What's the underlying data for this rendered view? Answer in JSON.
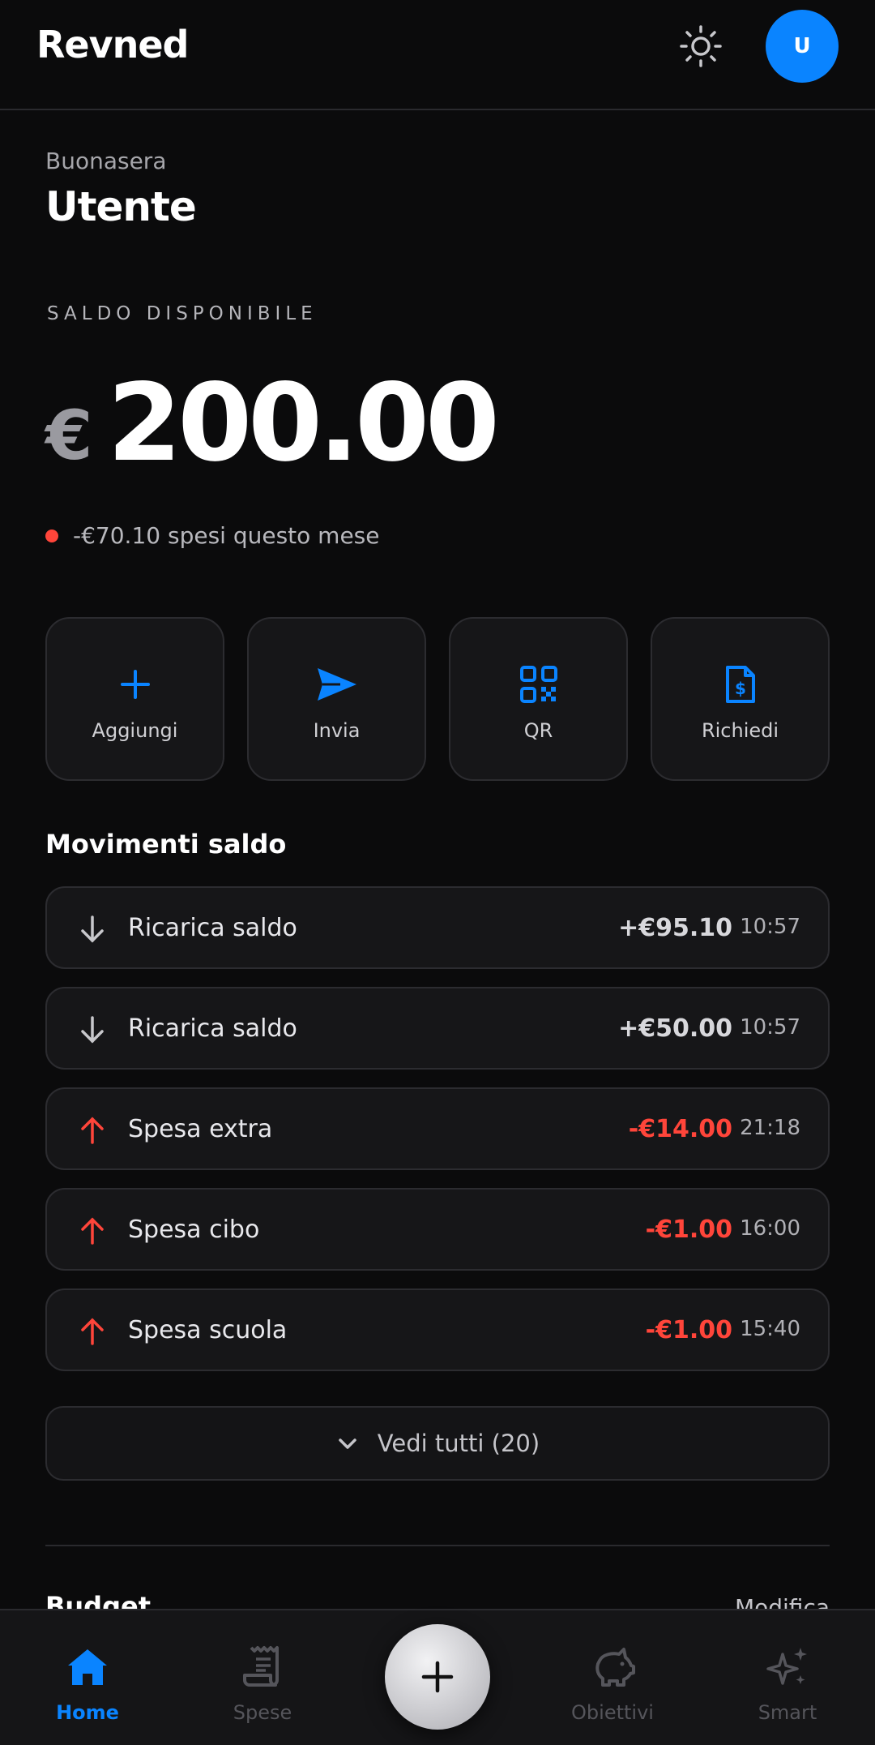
{
  "header": {
    "brand": "Revned",
    "avatar_initial": "U"
  },
  "greeting": {
    "salutation": "Buonasera",
    "name": "Utente"
  },
  "balance": {
    "label": "SALDO DISPONIBILE",
    "currency": "€",
    "amount": "200.00",
    "spent_text": "-€70.10 spesi questo mese"
  },
  "actions": [
    {
      "label": "Aggiungi",
      "icon": "plus-icon"
    },
    {
      "label": "Invia",
      "icon": "send-icon"
    },
    {
      "label": "QR",
      "icon": "qr-icon"
    },
    {
      "label": "Richiedi",
      "icon": "invoice-icon"
    }
  ],
  "movements": {
    "title": "Movimenti saldo",
    "items": [
      {
        "label": "Ricarica saldo",
        "amount": "+€95.10",
        "time": "10:57",
        "direction": "in"
      },
      {
        "label": "Ricarica saldo",
        "amount": "+€50.00",
        "time": "10:57",
        "direction": "in"
      },
      {
        "label": "Spesa extra",
        "amount": "-€14.00",
        "time": "21:18",
        "direction": "out"
      },
      {
        "label": "Spesa cibo",
        "amount": "-€1.00",
        "time": "16:00",
        "direction": "out"
      },
      {
        "label": "Spesa scuola",
        "amount": "-€1.00",
        "time": "15:40",
        "direction": "out"
      }
    ],
    "see_all": "Vedi tutti (20)"
  },
  "budget": {
    "title": "Budget",
    "edit": "Modifica"
  },
  "nav": {
    "home": "Home",
    "spese": "Spese",
    "obiettivi": "Obiettivi",
    "smart": "Smart"
  },
  "colors": {
    "accent": "#0a84ff",
    "negative": "#ff453a",
    "background": "#0b0b0c"
  }
}
